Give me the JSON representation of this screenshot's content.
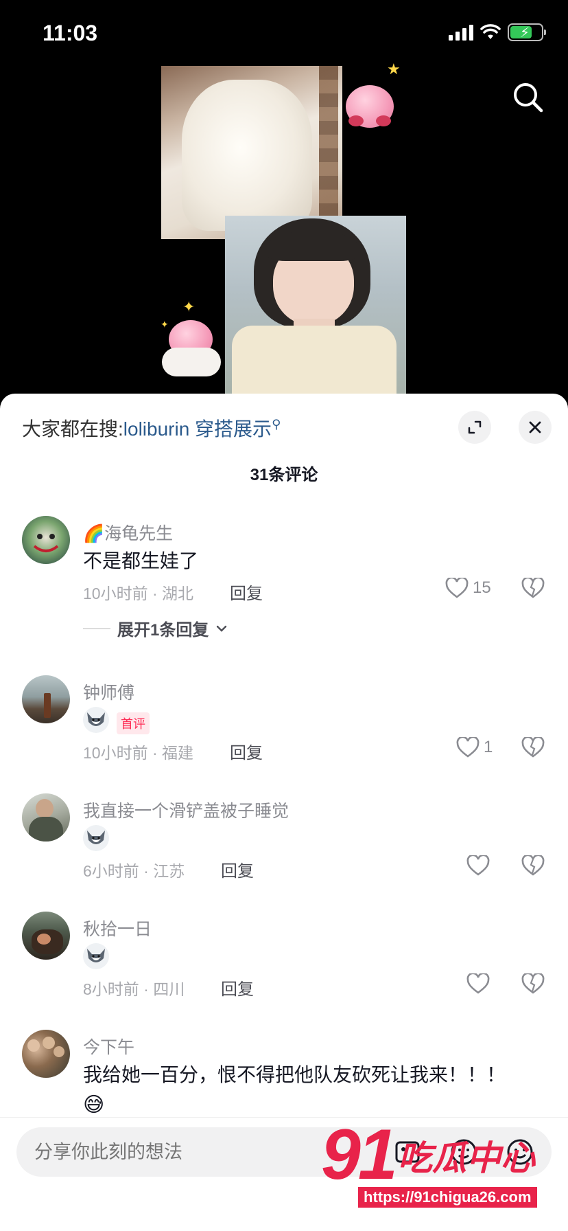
{
  "status_bar": {
    "time": "11:03"
  },
  "sheet": {
    "trending_prefix": "大家都在搜:",
    "trending_link": "loliburin 穿搭展示",
    "comment_count": "31条评论"
  },
  "comments": [
    {
      "username": "🌈海龟先生",
      "text": "不是都生娃了",
      "meta": "10小时前 · 湖北",
      "reply": "回复",
      "likes": "15",
      "expand": "展开1条回复"
    },
    {
      "username": "钟师傅",
      "badge": "首评",
      "meta": "10小时前 · 福建",
      "reply": "回复",
      "likes": "1"
    },
    {
      "username": "我直接一个滑铲盖被子睡觉",
      "meta": "6小时前 · 江苏",
      "reply": "回复",
      "likes": ""
    },
    {
      "username": "秋拾一日",
      "meta": "8小时前 · 四川",
      "reply": "回复",
      "likes": ""
    },
    {
      "username": "今下午",
      "text": "我给她一百分，恨不得把他队友砍死让我来！！！",
      "emoji": "😅"
    }
  ],
  "input": {
    "placeholder": "分享你此刻的想法"
  },
  "watermark": {
    "number": "91",
    "text": "吃瓜中心",
    "url": "https://91chigua26.com"
  },
  "colors": {
    "accent": "#fe2c55",
    "link": "#2b5a8c",
    "watermark": "#e8234a"
  },
  "icons": [
    "search-icon",
    "expand-icon",
    "close-icon",
    "heart-icon",
    "broken-heart-icon",
    "emoji-icon",
    "at-icon",
    "image-icon",
    "wolf-sticker"
  ]
}
